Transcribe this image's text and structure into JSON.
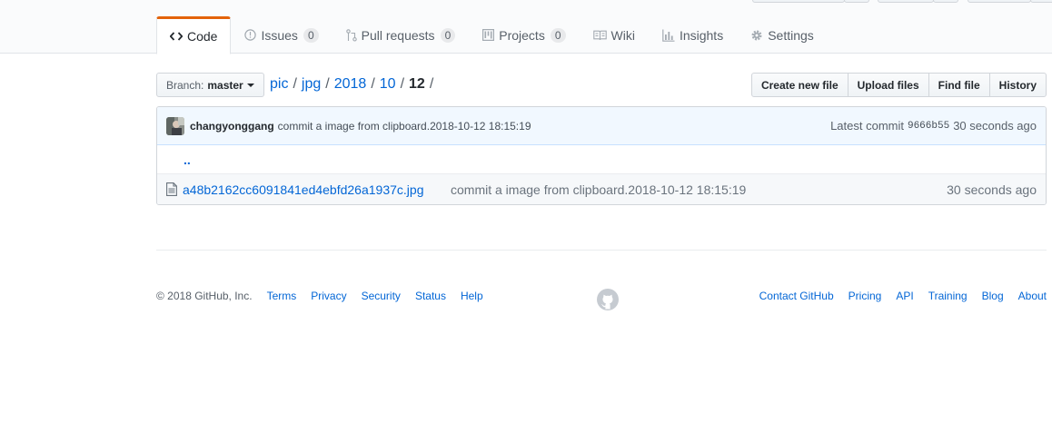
{
  "repo_tabs": [
    {
      "label": "Code",
      "icon": "code-icon",
      "selected": true
    },
    {
      "label": "Issues",
      "icon": "issue-icon",
      "count": "0"
    },
    {
      "label": "Pull requests",
      "icon": "pull-request-icon",
      "count": "0"
    },
    {
      "label": "Projects",
      "icon": "project-icon",
      "count": "0"
    },
    {
      "label": "Wiki",
      "icon": "book-icon"
    },
    {
      "label": "Insights",
      "icon": "graph-icon"
    },
    {
      "label": "Settings",
      "icon": "gear-icon"
    }
  ],
  "branch": {
    "key": "Branch:",
    "value": "master"
  },
  "breadcrumb": {
    "parts": [
      "pic",
      "jpg",
      "2018",
      "10"
    ],
    "current": "12",
    "separator": "/"
  },
  "file_actions": [
    "Create new file",
    "Upload files",
    "Find file",
    "History"
  ],
  "commit": {
    "author": "changyonggang",
    "message": "commit a image from clipboard.2018-10-12 18:15:19",
    "latest_label": "Latest commit",
    "sha": "9666b55",
    "age": "30 seconds ago"
  },
  "files": {
    "up_dir": "..",
    "items": [
      {
        "name": "a48b2162cc6091841ed4ebfd26a1937c.jpg",
        "message": "commit a image from clipboard.2018-10-12 18:15:19",
        "age": "30 seconds ago",
        "icon": "file-icon"
      }
    ]
  },
  "footer": {
    "copyright": "© 2018 GitHub, Inc.",
    "left_links": [
      "Terms",
      "Privacy",
      "Security",
      "Status",
      "Help"
    ],
    "right_links": [
      "Contact GitHub",
      "Pricing",
      "API",
      "Training",
      "Blog",
      "About"
    ],
    "logo_icon": "github-mark-icon"
  },
  "colors": {
    "accent": "#0366d6",
    "tab_underline": "#e36209",
    "commit_bg": "#f1f8ff"
  }
}
